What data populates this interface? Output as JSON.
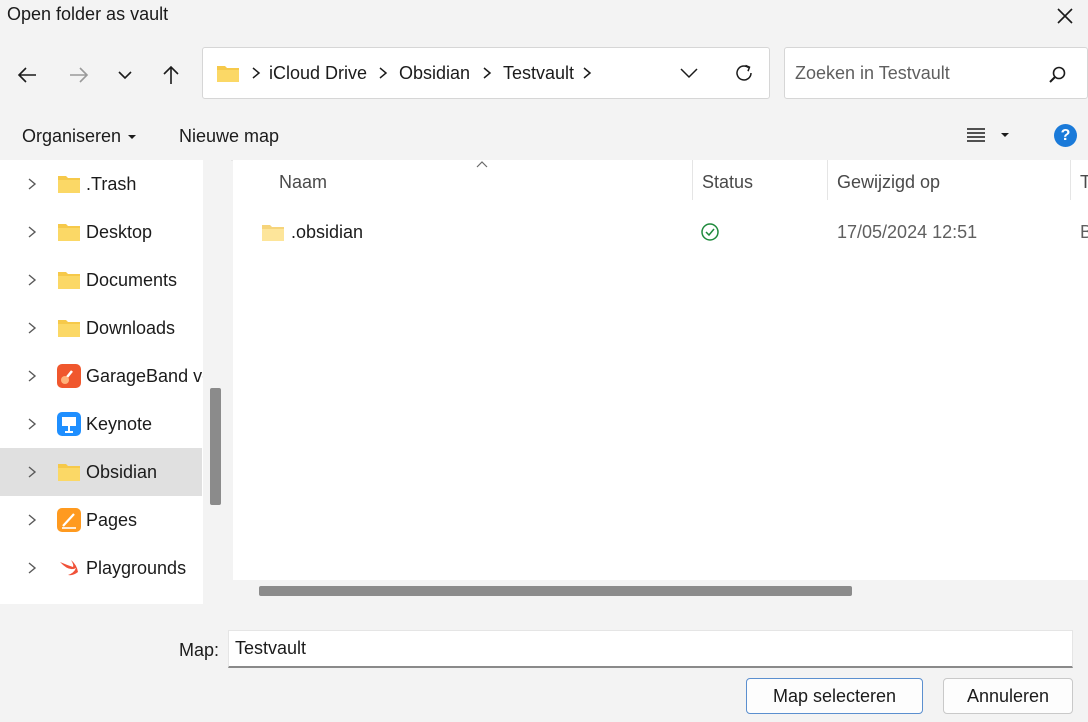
{
  "window": {
    "title": "Open folder as vault"
  },
  "nav": {
    "breadcrumbs": [
      "iCloud Drive",
      "Obsidian",
      "Testvault"
    ],
    "search_placeholder": "Zoeken in Testvault"
  },
  "toolbar": {
    "organize_label": "Organiseren",
    "new_folder_label": "Nieuwe map",
    "help_label": "?"
  },
  "sidebar": {
    "items": [
      {
        "label": ".Trash",
        "icon": "folder-icon"
      },
      {
        "label": "Desktop",
        "icon": "folder-icon"
      },
      {
        "label": "Documents",
        "icon": "folder-icon"
      },
      {
        "label": "Downloads",
        "icon": "folder-icon"
      },
      {
        "label": "GarageBand vo",
        "icon": "garageband-icon"
      },
      {
        "label": "Keynote",
        "icon": "keynote-icon"
      },
      {
        "label": "Obsidian",
        "icon": "folder-icon",
        "selected": true
      },
      {
        "label": "Pages",
        "icon": "pages-icon"
      },
      {
        "label": "Playgrounds",
        "icon": "swift-playgrounds-icon"
      }
    ]
  },
  "file_list": {
    "columns": [
      "Naam",
      "Status",
      "Gewijzigd op",
      "T"
    ],
    "rows": [
      {
        "name": ".obsidian",
        "status": "synced",
        "modified": "17/05/2024 12:51",
        "type": "B"
      }
    ]
  },
  "footer": {
    "map_label": "Map:",
    "map_value": "Testvault",
    "select_button": "Map selecteren",
    "cancel_button": "Annuleren"
  },
  "colors": {
    "accent": "#1a7ad9",
    "folder": "#f6c94a",
    "status_ok": "#1f8a3c"
  }
}
